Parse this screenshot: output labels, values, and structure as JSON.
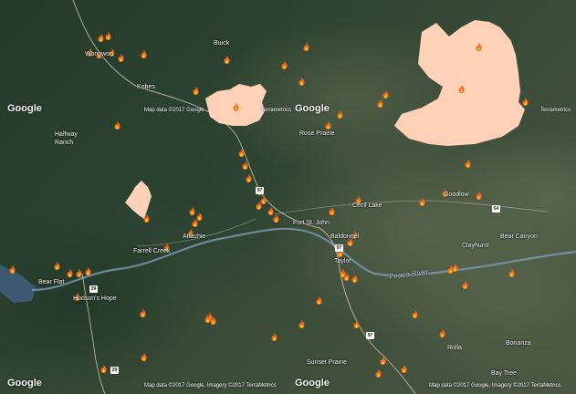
{
  "colors": {
    "burn_area": "#ffd1b8",
    "fire_outer": "#f26a1b",
    "fire_inner": "#ffd23f",
    "river": "#7e9bb4"
  },
  "map": {
    "icon": "fire-icon",
    "google_logo": "Google",
    "attribution_short": "Map data ©2017 Google",
    "attribution_terra": "Terrametrics",
    "attribution_long": "Map data ©2017 Google, Imagery ©2017 TerraMetrics",
    "places": [
      {
        "id": "wonowon",
        "label": "Wonowon"
      },
      {
        "id": "buick",
        "label": "Buick"
      },
      {
        "id": "kobes",
        "label": "Kobes"
      },
      {
        "id": "halfway-ranch",
        "label": "Halfway\nRanch"
      },
      {
        "id": "rose-prairie",
        "label": "Rose Prairie"
      },
      {
        "id": "fort-st-john",
        "label": "Fort St. John"
      },
      {
        "id": "cecil-lake",
        "label": "Cecil Lake"
      },
      {
        "id": "goodlow",
        "label": "Goodlow"
      },
      {
        "id": "baldonnel",
        "label": "Baldonnel"
      },
      {
        "id": "taylor",
        "label": "Taylor"
      },
      {
        "id": "clayhurst",
        "label": "Clayhurst"
      },
      {
        "id": "bear-canyon",
        "label": "Bear Canyon"
      },
      {
        "id": "farrell-creek",
        "label": "Farrell Creek"
      },
      {
        "id": "attachie",
        "label": "Attachie"
      },
      {
        "id": "bear-flat",
        "label": "Bear Flat"
      },
      {
        "id": "hudsons-hope",
        "label": "Hudson's Hope"
      },
      {
        "id": "peace-river",
        "label": "Peace River"
      },
      {
        "id": "sunset-prairie",
        "label": "Sunset Prairie"
      },
      {
        "id": "rolla",
        "label": "Rolla"
      },
      {
        "id": "bonanza",
        "label": "Bonanza"
      },
      {
        "id": "bay-tree",
        "label": "Bay Tree"
      }
    ],
    "route_shields": [
      "97",
      "97",
      "29",
      "29",
      "97",
      "64"
    ]
  }
}
